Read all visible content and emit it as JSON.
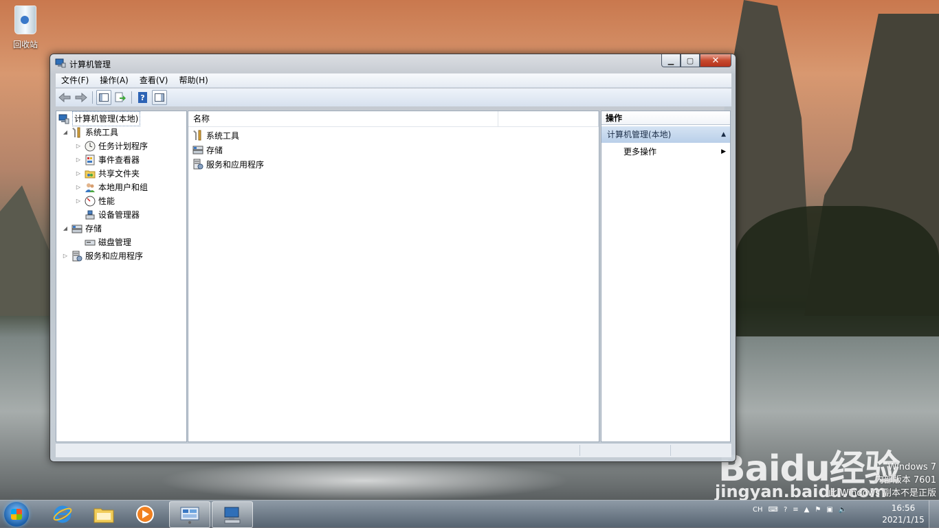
{
  "desktop": {
    "recycle_bin_label": "回收站"
  },
  "window": {
    "title": "计算机管理",
    "menu": [
      "文件(F)",
      "操作(A)",
      "查看(V)",
      "帮助(H)"
    ]
  },
  "tree": {
    "root": "计算机管理(本地)",
    "items": [
      {
        "label": "系统工具",
        "icon": "tools-icon"
      },
      {
        "label": "任务计划程序",
        "icon": "clock-icon"
      },
      {
        "label": "事件查看器",
        "icon": "event-viewer-icon"
      },
      {
        "label": "共享文件夹",
        "icon": "shared-folder-icon"
      },
      {
        "label": "本地用户和组",
        "icon": "users-icon"
      },
      {
        "label": "性能",
        "icon": "performance-icon"
      },
      {
        "label": "设备管理器",
        "icon": "device-manager-icon"
      },
      {
        "label": "存储",
        "icon": "storage-icon"
      },
      {
        "label": "磁盘管理",
        "icon": "disk-icon"
      },
      {
        "label": "服务和应用程序",
        "icon": "services-icon"
      }
    ]
  },
  "center": {
    "column_name": "名称",
    "rows": [
      "系统工具",
      "存储",
      "服务和应用程序"
    ]
  },
  "actions": {
    "header": "操作",
    "section": "计算机管理(本地)",
    "more": "更多操作"
  },
  "watermark": {
    "line1": "Windows 7",
    "line2": "内部版本 7601",
    "line3": "此 Windows 副本不是正版",
    "brand": "Baidu经验",
    "url": "jingyan.baidu.com"
  },
  "tray": {
    "lang": "CH"
  },
  "clock": {
    "time": "16:56",
    "date": "2021/1/15"
  }
}
